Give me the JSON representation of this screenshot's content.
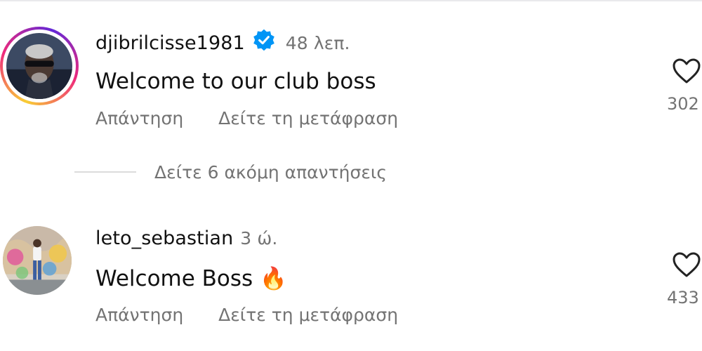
{
  "comments": [
    {
      "username": "djibrilcisse1981",
      "verified": true,
      "time": "48 λεπ.",
      "text": "Welcome to our club boss",
      "reply_label": "Απάντηση",
      "translate_label": "Δείτε τη μετάφραση",
      "likes": "302",
      "avatar": "profile-photo-man-sunglasses"
    },
    {
      "username": "leto_sebastian",
      "verified": false,
      "time": "3 ώ.",
      "text": "Welcome Boss",
      "emoji": "🔥",
      "reply_label": "Απάντηση",
      "translate_label": "Δείτε τη μετάφραση",
      "likes": "433",
      "avatar": "profile-photo-graffiti-wall"
    }
  ],
  "more_replies": "Δείτε 6 ακόμη απαντήσεις",
  "colors": {
    "secondary_text": "#737373",
    "verified_blue": "#0095f6",
    "divider": "#dbdbdb"
  }
}
